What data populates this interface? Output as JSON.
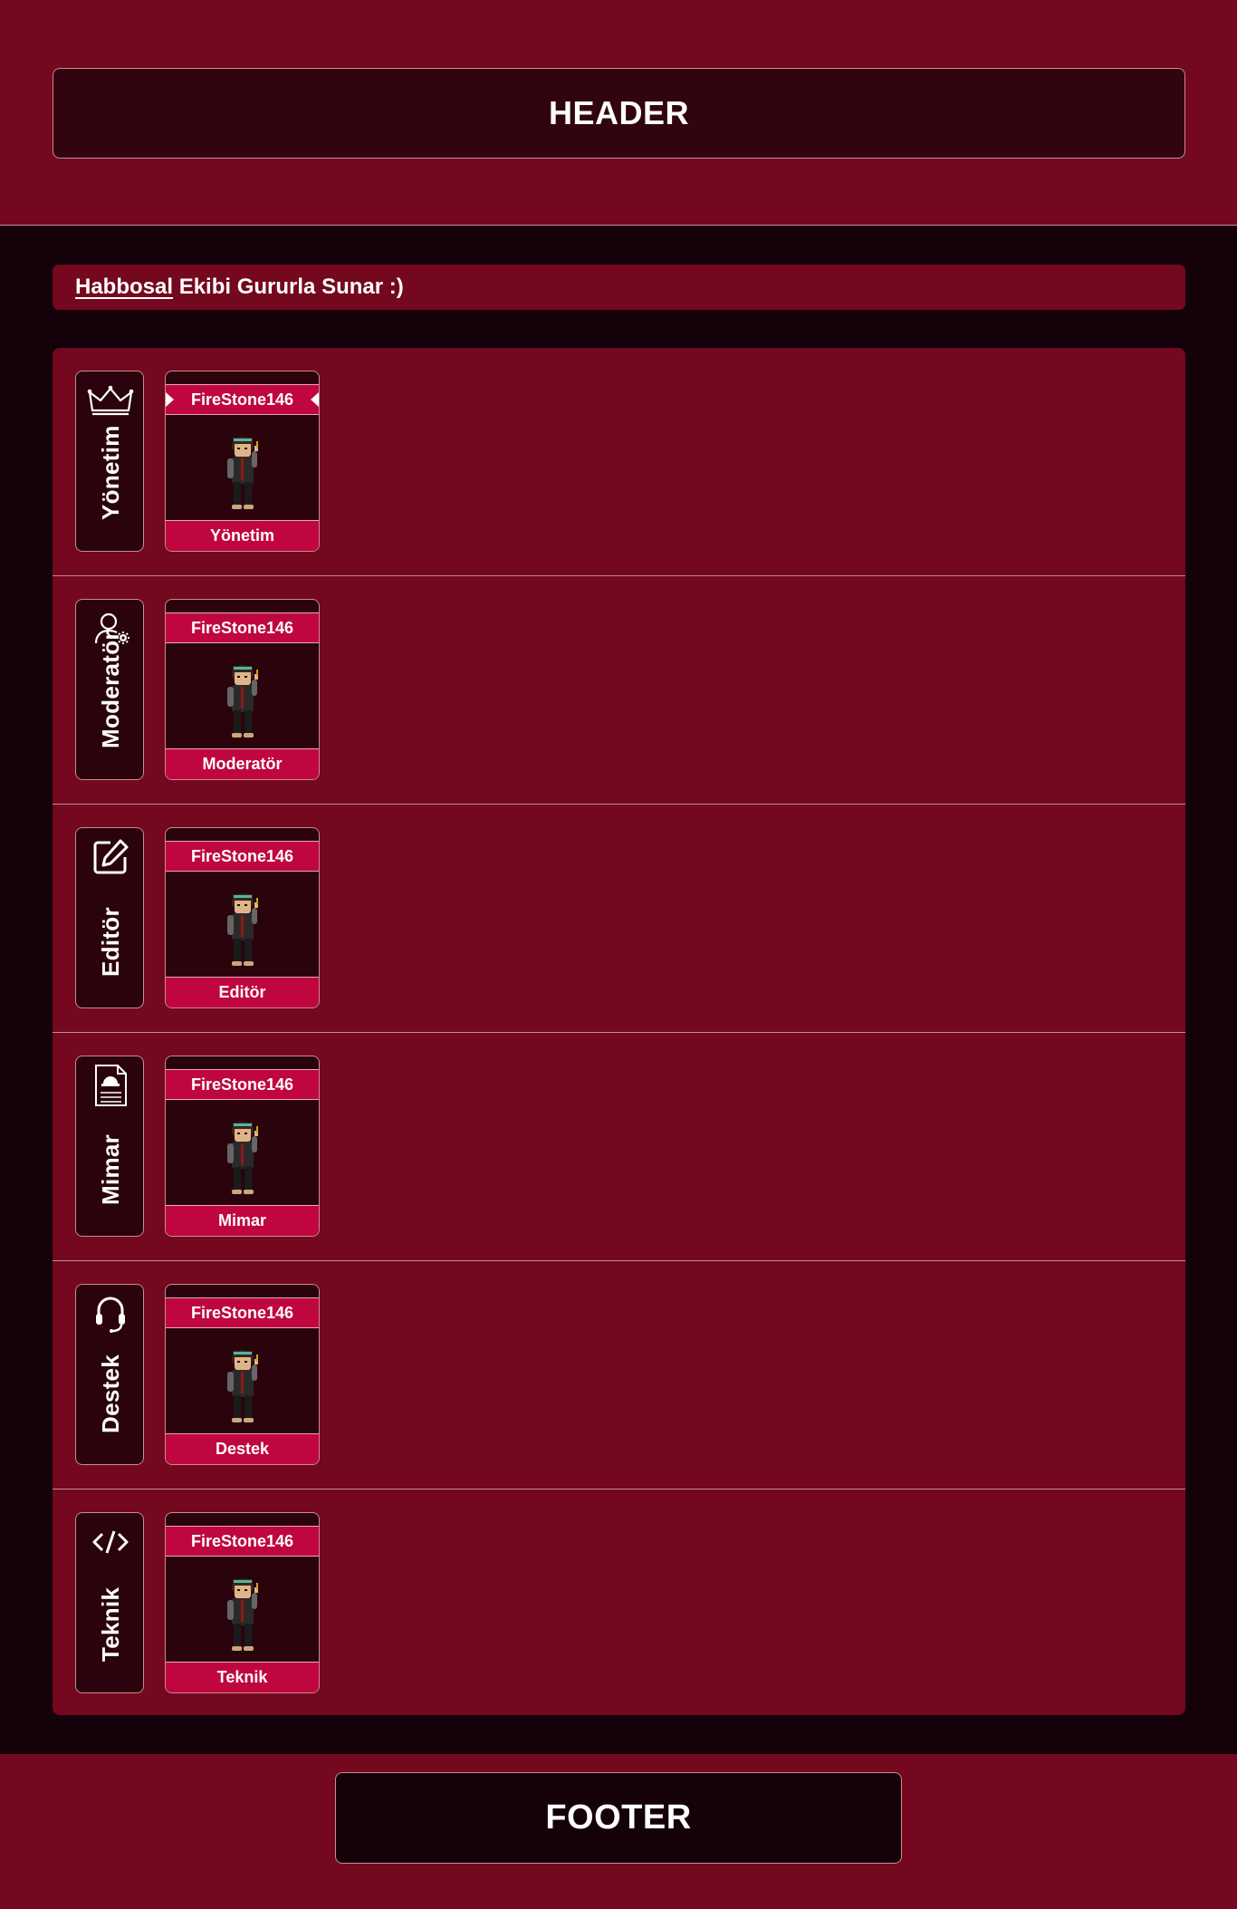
{
  "header": {
    "title": "HEADER"
  },
  "tagline": {
    "brand": "Habbosal",
    "rest": " Ekibi Gururla Sunar :)"
  },
  "team": [
    {
      "rank": "Yönetim",
      "icon": "crown-icon",
      "member": "FireStone146",
      "role": "Yönetim"
    },
    {
      "rank": "Moderatör",
      "icon": "user-gear-icon",
      "member": "FireStone146",
      "role": "Moderatör"
    },
    {
      "rank": "Editör",
      "icon": "edit-icon",
      "member": "FireStone146",
      "role": "Editör"
    },
    {
      "rank": "Mimar",
      "icon": "blueprint-document-icon",
      "member": "FireStone146",
      "role": "Mimar"
    },
    {
      "rank": "Destek",
      "icon": "headset-icon",
      "member": "FireStone146",
      "role": "Destek"
    },
    {
      "rank": "Teknik",
      "icon": "code-icon",
      "member": "FireStone146",
      "role": "Teknik"
    }
  ],
  "footer": {
    "title": "FOOTER"
  },
  "colors": {
    "background": "#14010a",
    "panel": "#73081e",
    "dark_box": "#2a030c",
    "accent": "#c0063f",
    "border": "#c98a96"
  }
}
